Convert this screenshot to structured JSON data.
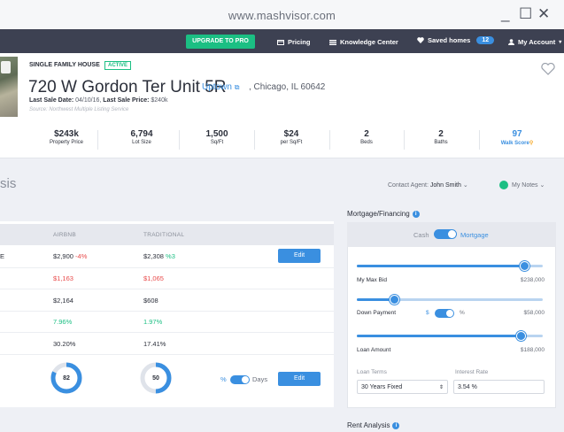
{
  "browser": {
    "url": "www.mashvisor.com"
  },
  "navbar": {
    "upgrade_label": "UPGRADE TO PRO",
    "pricing_label": "Pricing",
    "knowledge_label": "Knowledge Center",
    "saved_label": "Saved homes",
    "saved_count": "12",
    "account_label": "My Account"
  },
  "property": {
    "type": "SINGLE FAMILY HOUSE",
    "status": "ACTIVE",
    "address": "720 W Gordon Ter Unit 5R",
    "neighborhood": "Uptown",
    "city": ", Chicago, IL 60642",
    "last_sale_date_label": "Last Sale Date:",
    "last_sale_date": "04/10/16,",
    "last_sale_price_label": "Last Sale Price:",
    "last_sale_price": "$240k",
    "source": "Source: Northwest Multiple Listing Service",
    "stats": [
      {
        "value": "$243k",
        "label": "Property Price"
      },
      {
        "value": "6,794",
        "label": "Lot Size"
      },
      {
        "value": "1,500",
        "label": "Sq/Ft"
      },
      {
        "value": "$24",
        "label": "per Sq/Ft"
      },
      {
        "value": "2",
        "label": "Beds"
      },
      {
        "value": "2",
        "label": "Baths"
      },
      {
        "value": "97",
        "label": "Walk Score"
      }
    ]
  },
  "analysis": {
    "title": "sis",
    "contact_label": "Contact Agent:",
    "contact_name": "John Smith",
    "notes_label": "My Notes",
    "columns": {
      "airbnb": "AIRBNB",
      "traditional": "TRADITIONAL"
    },
    "rows": [
      {
        "label": "E",
        "airbnb": "$2,900",
        "airbnb_change": "-4%",
        "traditional": "$2,308",
        "traditional_change": "%3"
      },
      {
        "label": "",
        "airbnb": "$1,163",
        "airbnb_change": "",
        "traditional": "$1,065",
        "traditional_change": ""
      },
      {
        "label": "",
        "airbnb": "$2,164",
        "airbnb_change": "",
        "traditional": "$608",
        "traditional_change": ""
      },
      {
        "label": "",
        "airbnb": "7.96%",
        "airbnb_change": "",
        "traditional": "1.97%",
        "traditional_change": ""
      },
      {
        "label": "",
        "airbnb": "30.20%",
        "airbnb_change": "",
        "traditional": "17.41%",
        "traditional_change": ""
      }
    ],
    "edit_label": "Edit",
    "occupancy": {
      "airbnb": "82",
      "traditional": "50",
      "percent_label": "%",
      "days_label": "Days"
    }
  },
  "mortgage": {
    "title": "Mortgage/Financing",
    "cash_label": "Cash",
    "mortgage_label": "Mortgage",
    "max_bid_label": "My Max Bid",
    "max_bid_value": "$238,000",
    "max_bid_fraction": 0.9,
    "down_payment_label": "Down Payment",
    "down_dollar": "$",
    "down_percent": "%",
    "down_payment_value": "$58,000",
    "down_payment_fraction": 0.2,
    "loan_amount_label": "Loan Amount",
    "loan_amount_value": "$188,000",
    "loan_amount_fraction": 0.88,
    "loan_terms_label": "Loan Terms",
    "loan_terms_value": "30 Years Fixed",
    "interest_rate_label": "Interest Rate",
    "interest_rate_value": "3.54 %"
  },
  "rent_analysis": {
    "title": "Rent Analysis"
  },
  "colors": {
    "accent": "#3a8fe0",
    "brand_green": "#1bbf83",
    "negative": "#e84b4b",
    "nav": "#3d4152"
  }
}
